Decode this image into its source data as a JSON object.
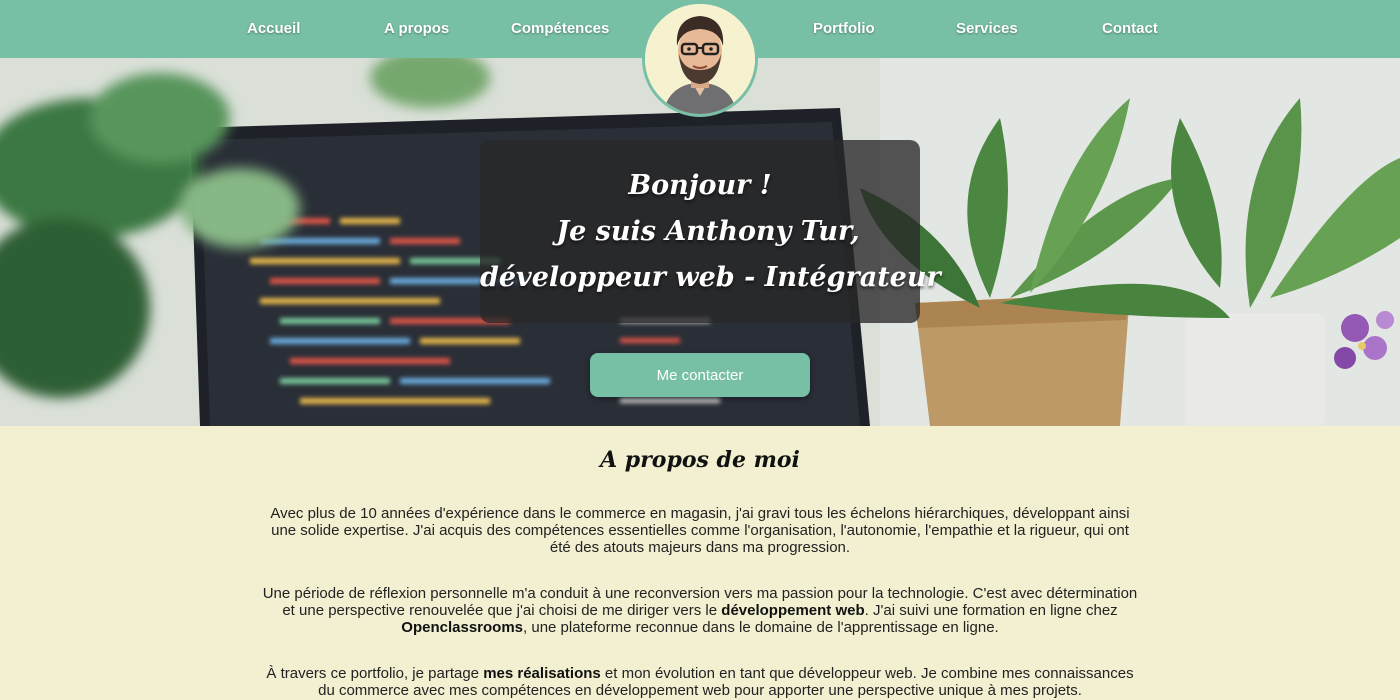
{
  "nav": {
    "items": [
      "Accueil",
      "A propos",
      "Compétences",
      "Portfolio",
      "Services",
      "Contact"
    ]
  },
  "hero": {
    "line1": "Bonjour !",
    "line2": "Je suis Anthony Tur,",
    "line3": "développeur web - Intégrateur",
    "cta": "Me contacter"
  },
  "about": {
    "title": "A propos de moi",
    "p1": "Avec plus de 10 années d'expérience dans le commerce en magasin, j'ai gravi tous les échelons hiérarchiques, développant ainsi une solide expertise. J'ai acquis des compétences essentielles comme l'organisation, l'autonomie, l'empathie et la rigueur, qui ont été des atouts majeurs dans ma progression.",
    "p2": {
      "a": "Une période de réflexion personnelle m'a conduit à une reconversion vers ma passion pour la technologie. C'est avec détermination et une perspective renouvelée que j'ai choisi de me diriger vers le ",
      "b": "développement web",
      "c": ". J'ai suivi une formation en ligne chez ",
      "d": "Openclassrooms",
      "e": ", une plateforme reconnue dans le domaine de l'apprentissage en ligne."
    },
    "p3": {
      "a": "À travers ce portfolio, je partage ",
      "b": "mes réalisations",
      "c": " et mon évolution en tant que développeur web. Je combine mes connaissances du commerce avec mes compétences en développement web pour apporter une perspective unique à mes projets."
    }
  },
  "colors": {
    "accent": "#78c0a5",
    "background": "#f2f0d1",
    "overlay": "#282828"
  },
  "icons": {
    "avatar": "avatar-illustration"
  }
}
